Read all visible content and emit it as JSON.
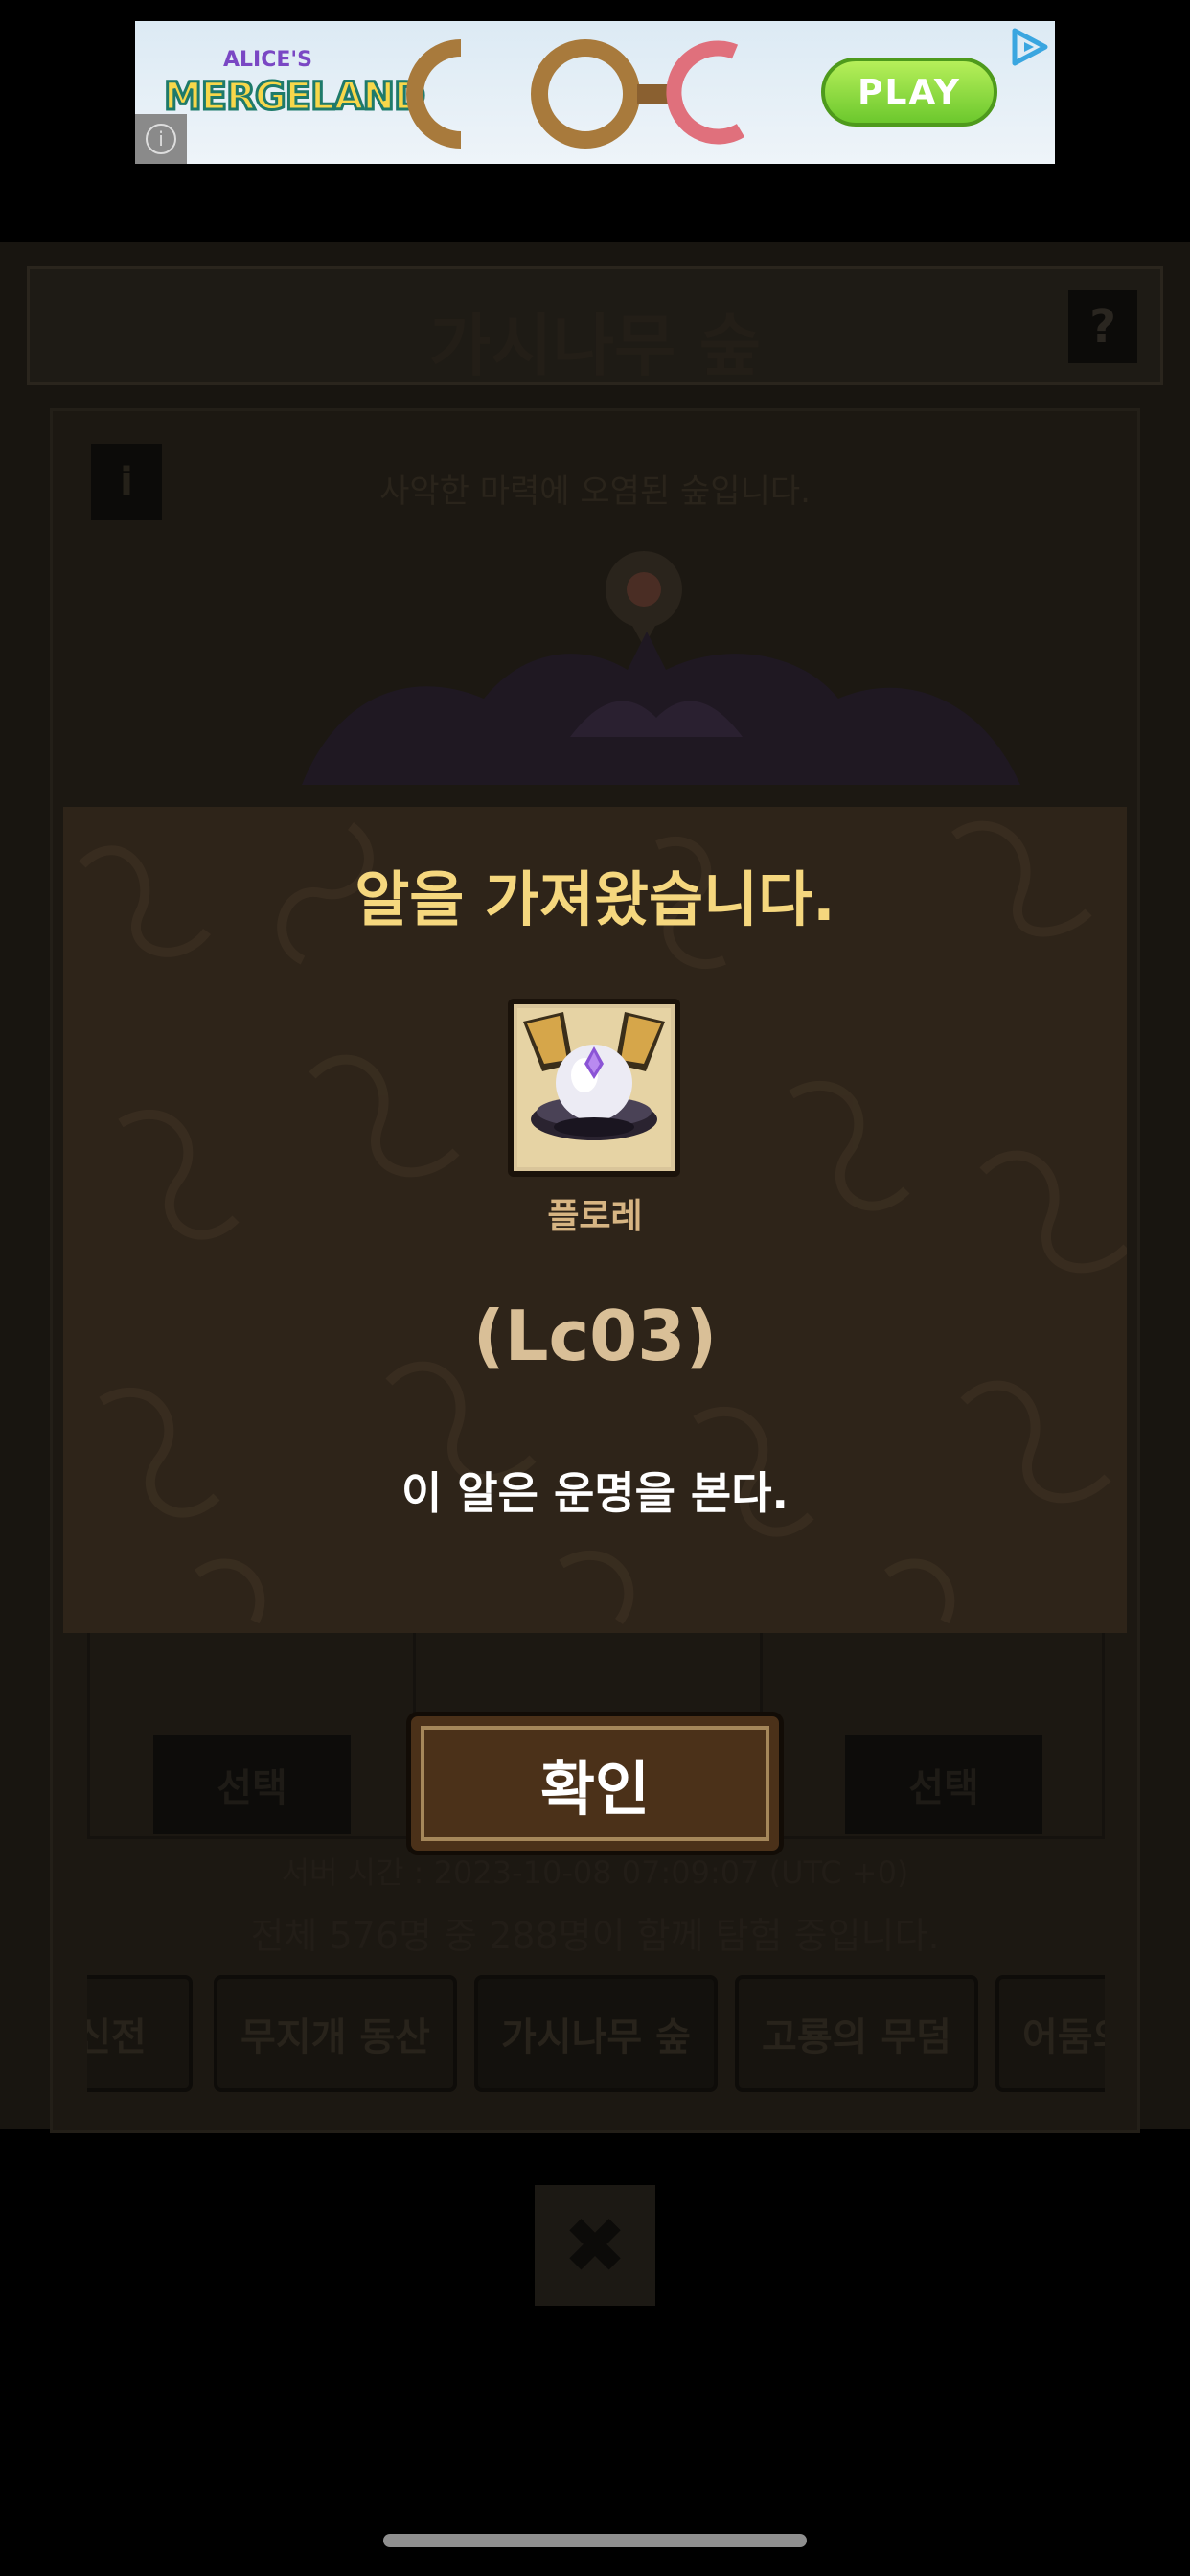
{
  "ad": {
    "brand_small": "ALICE'S",
    "brand_large": "MERGELAND",
    "play_label": "PLAY",
    "info_icon": "info-icon",
    "adchoices_icon": "adchoices-icon"
  },
  "header": {
    "title": "가시나무 숲",
    "help_label": "?"
  },
  "zone": {
    "info_label": "i",
    "subtitle": "사악한 마력에 오염된 숲입니다."
  },
  "choices": [
    {
      "select_label": "선택"
    },
    {
      "select_label": ""
    },
    {
      "select_label": "선택"
    }
  ],
  "footer": {
    "server_time": "서버 시간 : 2023-10-08 07:09:07 (UTC +0)",
    "users_line": "전체 576명 중 288명이 함께 탐험 중입니다."
  },
  "zone_tabs": [
    {
      "label": "신전"
    },
    {
      "label": "무지개 동산"
    },
    {
      "label": "가시나무 숲"
    },
    {
      "label": "고룡의 무덤"
    },
    {
      "label": "어둠의"
    }
  ],
  "close_label": "✖",
  "modal": {
    "title": "알을 가져왔습니다.",
    "egg_name": "플로레",
    "egg_code": "(Lc03)",
    "egg_description": "이 알은 운명을 본다.",
    "confirm_label": "확인"
  },
  "colors": {
    "modal_bg": "#2e2419",
    "title_gold": "#f5d77e",
    "confirm_bg": "#4b3119"
  }
}
